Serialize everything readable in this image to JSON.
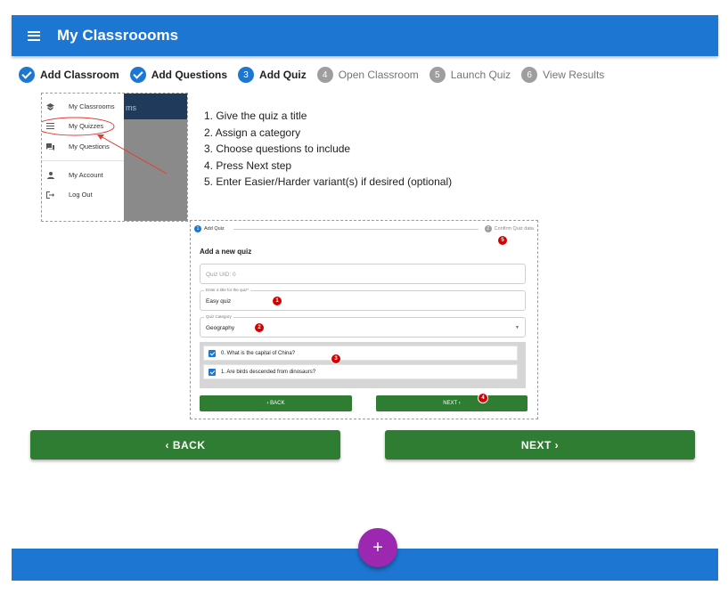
{
  "app": {
    "title": "My Classroooms"
  },
  "stepper": [
    {
      "label": "Add Classroom",
      "state": "done",
      "number": "1"
    },
    {
      "label": "Add Questions",
      "state": "done",
      "number": "2"
    },
    {
      "label": "Add Quiz",
      "state": "active",
      "number": "3"
    },
    {
      "label": "Open Classroom",
      "state": "pending",
      "number": "4"
    },
    {
      "label": "Launch Quiz",
      "state": "pending",
      "number": "5"
    },
    {
      "label": "View Results",
      "state": "pending",
      "number": "6"
    }
  ],
  "nav_screenshot": {
    "header_fragment": "ms",
    "items": [
      {
        "label": "My Classrooms",
        "icon": "school-icon"
      },
      {
        "label": "My Quizzes",
        "icon": "list-icon"
      },
      {
        "label": "My Questions",
        "icon": "forum-icon"
      },
      {
        "label": "My Account",
        "icon": "person-icon"
      },
      {
        "label": "Log Out",
        "icon": "logout-icon"
      }
    ]
  },
  "instructions": [
    "1. Give the quiz a title",
    "2. Assign a category",
    "3. Choose questions to include",
    "4. Press Next step",
    "5. Enter Easier/Harder variant(s) if desired (optional)"
  ],
  "quiz_screenshot": {
    "step1_label": "Add Quiz",
    "step1_number": "1",
    "step2_label": "Confirm Quiz data",
    "step2_number": "2",
    "heading": "Add a new quiz",
    "uid_placeholder": "Quiz UID: 0",
    "title_label": "Enter a title for the quiz*",
    "title_value": "Easy quiz",
    "category_label": "Quiz Category",
    "category_value": "Geography",
    "questions": [
      "0. What is the capital of China?",
      "1. Are birds descended from dinosaurs?"
    ],
    "back_label": "‹  BACK",
    "next_label": "NEXT  ›",
    "badges": [
      "1",
      "2",
      "3",
      "4",
      "5"
    ]
  },
  "buttons": {
    "back": "‹  BACK",
    "next": "NEXT  ›"
  },
  "fab": {
    "label": "+"
  },
  "colors": {
    "primary": "#1e76d3",
    "success": "#2e7d32",
    "fab": "#9c27b0",
    "annotation": "#d50000"
  }
}
